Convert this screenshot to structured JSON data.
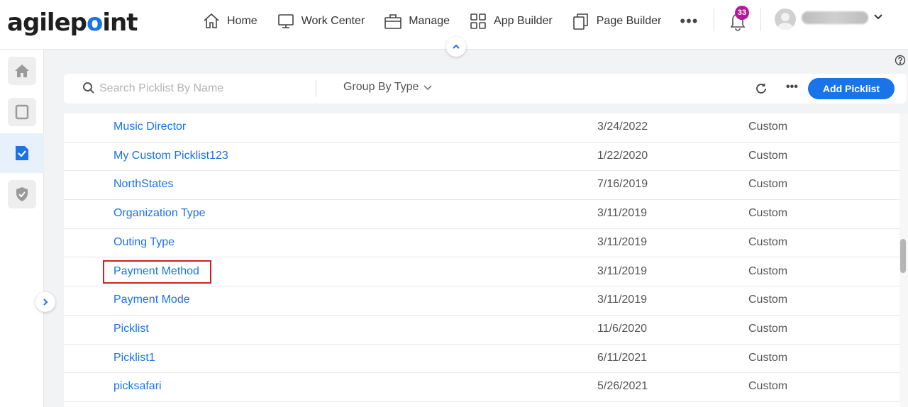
{
  "app": {
    "logo_text": "agilepoint",
    "accent_color": "#1a73e8"
  },
  "nav": {
    "items": [
      {
        "label": "Home",
        "icon": "home-icon"
      },
      {
        "label": "Work Center",
        "icon": "monitor-icon"
      },
      {
        "label": "Manage",
        "icon": "briefcase-icon"
      },
      {
        "label": "App Builder",
        "icon": "grid-icon"
      },
      {
        "label": "Page Builder",
        "icon": "pages-icon"
      }
    ],
    "more_label": "•••",
    "notification_count": "33"
  },
  "sidebar": {
    "items": [
      {
        "name": "home",
        "icon": "home-icon",
        "active": false
      },
      {
        "name": "work-center",
        "icon": "tablet-icon",
        "active": false
      },
      {
        "name": "picklists",
        "icon": "checklist-icon",
        "active": true
      },
      {
        "name": "security",
        "icon": "shield-icon",
        "active": false
      }
    ]
  },
  "toolbar": {
    "search_placeholder": "Search Picklist By Name",
    "group_by_label": "Group By Type",
    "more_label": "•••",
    "add_label": "Add Picklist"
  },
  "table": {
    "rows": [
      {
        "name": "Music Director",
        "date": "3/24/2022",
        "type": "Custom"
      },
      {
        "name": "My Custom Picklist123",
        "date": "1/22/2020",
        "type": "Custom"
      },
      {
        "name": "NorthStates",
        "date": "7/16/2019",
        "type": "Custom"
      },
      {
        "name": "Organization Type",
        "date": "3/11/2019",
        "type": "Custom"
      },
      {
        "name": "Outing Type",
        "date": "3/11/2019",
        "type": "Custom"
      },
      {
        "name": "Payment Method",
        "date": "3/11/2019",
        "type": "Custom"
      },
      {
        "name": "Payment Mode",
        "date": "3/11/2019",
        "type": "Custom"
      },
      {
        "name": "Picklist",
        "date": "11/6/2020",
        "type": "Custom"
      },
      {
        "name": "Picklist1",
        "date": "6/11/2021",
        "type": "Custom"
      },
      {
        "name": "picksafari",
        "date": "5/26/2021",
        "type": "Custom"
      }
    ],
    "highlighted_row": "Payment Method"
  }
}
